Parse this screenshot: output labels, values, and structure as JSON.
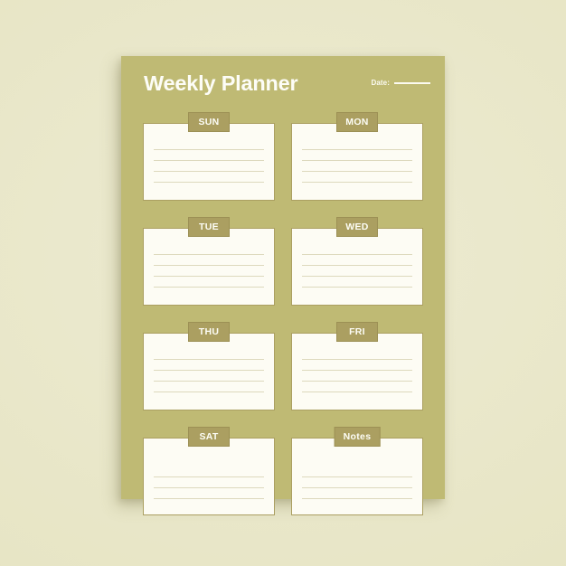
{
  "page": {
    "title": "Weekly Planner",
    "date_label": "Date:",
    "date_value": ""
  },
  "colors": {
    "canvas_background": "#e9e7ca",
    "page_background": "#bfba74",
    "card_background": "#fdfcf4",
    "card_border": "#ab9f61",
    "tab_background": "#ab9f61",
    "tab_border": "#9c9055",
    "rule_line": "#ddd9bd",
    "title_text": "#fdfdf7",
    "tab_text": "#fdfdf6"
  },
  "cards": [
    {
      "label": "SUN",
      "lines": 4,
      "lines_position": "normal",
      "content": ""
    },
    {
      "label": "MON",
      "lines": 4,
      "lines_position": "normal",
      "content": ""
    },
    {
      "label": "TUE",
      "lines": 4,
      "lines_position": "normal",
      "content": ""
    },
    {
      "label": "WED",
      "lines": 4,
      "lines_position": "normal",
      "content": ""
    },
    {
      "label": "THU",
      "lines": 4,
      "lines_position": "normal",
      "content": ""
    },
    {
      "label": "FRI",
      "lines": 4,
      "lines_position": "normal",
      "content": ""
    },
    {
      "label": "SAT",
      "lines": 3,
      "lines_position": "low",
      "content": ""
    },
    {
      "label": "Notes",
      "lines": 3,
      "lines_position": "low",
      "content": ""
    }
  ]
}
